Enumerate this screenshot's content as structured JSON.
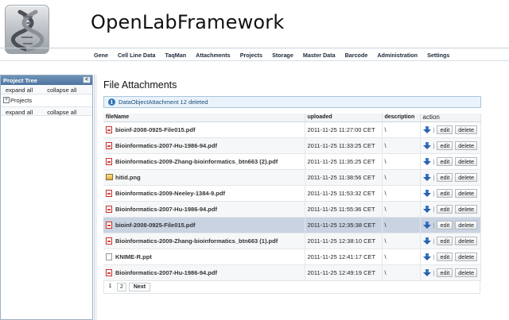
{
  "app": {
    "title": "OpenLabFramework"
  },
  "nav": [
    {
      "label": "Gene"
    },
    {
      "label": "Cell Line Data"
    },
    {
      "label": "TaqMan"
    },
    {
      "label": "Attachments"
    },
    {
      "label": "Projects"
    },
    {
      "label": "Storage"
    },
    {
      "label": "Master Data"
    },
    {
      "label": "Barcode"
    },
    {
      "label": "Administration"
    },
    {
      "label": "Settings"
    }
  ],
  "sidebar": {
    "title": "Project Tree",
    "collapse_glyph": "<",
    "expand_all": "expand all",
    "collapse_all": "collapse all",
    "node_toggle": "+",
    "root_node": "Projects"
  },
  "main": {
    "title": "File Attachments",
    "info_message": "DataObjectAttachment 12 deleted",
    "columns": [
      "fileName",
      "uploaded",
      "description",
      "action"
    ],
    "rows": [
      {
        "fileName": "bioinf-2008-0925-File015.pdf",
        "uploaded": "2011-11-25 11:27:00 CET",
        "description": "\\",
        "icon": "pdf-icon"
      },
      {
        "fileName": "Bioinformatics-2007-Hu-1986-94.pdf",
        "uploaded": "2011-11-25 11:33:25 CET",
        "description": "\\",
        "icon": "pdf-icon"
      },
      {
        "fileName": "Bioinformatics-2009-Zhang-bioinformatics_btn663 (2).pdf",
        "uploaded": "2011-11-25 11:35:25 CET",
        "description": "\\",
        "icon": "pdf-icon"
      },
      {
        "fileName": "hitid.png",
        "uploaded": "2011-11-25 11:38:56 CET",
        "description": "\\",
        "icon": "image-icon"
      },
      {
        "fileName": "Bioinformatics-2009-Neeley-1384-9.pdf",
        "uploaded": "2011-11-25 11:53:32 CET",
        "description": "\\",
        "icon": "pdf-icon"
      },
      {
        "fileName": "Bioinformatics-2007-Hu-1986-94.pdf",
        "uploaded": "2011-11-25 11:55:36 CET",
        "description": "\\",
        "icon": "pdf-icon"
      },
      {
        "fileName": "bioinf-2008-0925-File015.pdf",
        "uploaded": "2011-11-25 12:35:38 CET",
        "description": "\\",
        "icon": "pdf-icon",
        "selected": true
      },
      {
        "fileName": "Bioinformatics-2009-Zhang-bioinformatics_btn663 (1).pdf",
        "uploaded": "2011-11-25 12:38:10 CET",
        "description": "\\",
        "icon": "pdf-icon"
      },
      {
        "fileName": "KNIME-R.ppt",
        "uploaded": "2011-11-25 12:41:17 CET",
        "description": "\\",
        "icon": "document-icon"
      },
      {
        "fileName": "Bioinformatics-2007-Hu-1986-94.pdf",
        "uploaded": "2011-11-25 12:49:19 CET",
        "description": "\\",
        "icon": "pdf-icon"
      }
    ],
    "actions": {
      "separator": "|",
      "edit": "edit",
      "delete": "delete"
    },
    "pager": {
      "pages": [
        "1",
        "2"
      ],
      "current": "1",
      "next": "Next"
    }
  },
  "colors": {
    "header_bar": "#4d74a0",
    "info_bg": "#eaf3fb",
    "selected_row": "#c9d3e2"
  }
}
